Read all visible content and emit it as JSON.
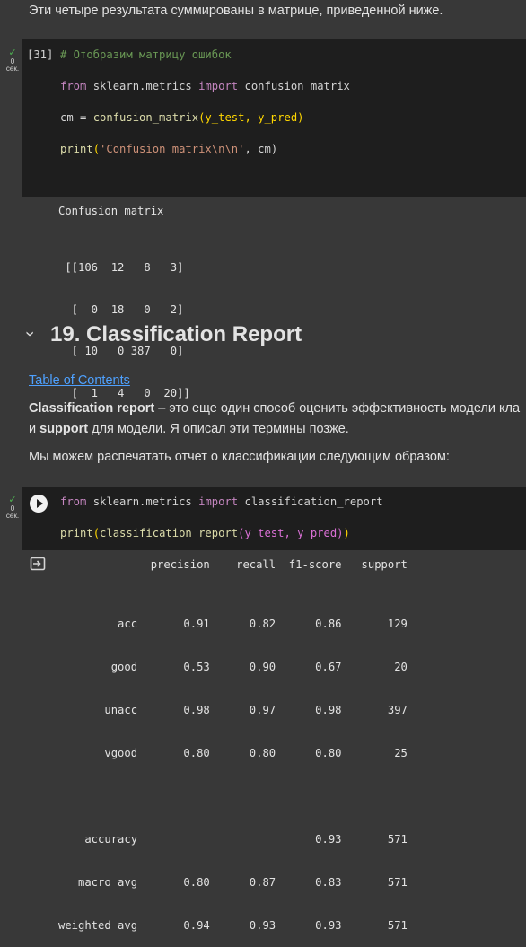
{
  "intro_text": "Эти четыре результата суммированы в матрице, приведенной ниже.",
  "cell1": {
    "status_label": "0 сек.",
    "exec_count": "[31]",
    "comment": "# Отобразим матрицу ошибок",
    "line_from": "from",
    "line_module": " sklearn.metrics ",
    "line_import": "import",
    "line_name": " confusion_matrix",
    "line2_a": "cm = ",
    "line2_fn": "confusion_matrix",
    "line2_args": "(y_test, y_pred)",
    "line3_fn": "print",
    "line3_str": "'Confusion matrix\\n\\n'",
    "line3_rest": ", cm)"
  },
  "cell1_output": {
    "title": "Confusion matrix",
    "matrix_lines": [
      " [[106  12   8   3]",
      "  [  0  18   0   2]",
      "  [ 10   0 387   0]",
      "  [  1   4   0  20]]"
    ]
  },
  "section": {
    "chevron": "›",
    "title": "19. Classification Report"
  },
  "toc_link": "Table of Contents",
  "paragraph1": {
    "bold1": "Classification report",
    "text1": " – это еще один способ оценить эффективность модели кла",
    "text2": "и ",
    "bold2": "support",
    "text3": " для модели. Я описал эти термины позже."
  },
  "paragraph2": "Мы можем распечатать отчет о классификации следующим образом:",
  "cell2": {
    "status_label": "0 сек.",
    "line1_from": "from",
    "line1_module": " sklearn.metrics ",
    "line1_import": "import",
    "line1_name": " classification_report",
    "line2_fn": "print",
    "line2_inner_fn": "classification_report",
    "line2_args": "(y_test, y_pred)"
  },
  "report": {
    "header": "              precision    recall  f1-score   support",
    "rows": [
      "         acc       0.91      0.82      0.86       129",
      "        good       0.53      0.90      0.67        20",
      "       unacc       0.98      0.97      0.98       397",
      "       vgood       0.80      0.80      0.80        25",
      "",
      "    accuracy                           0.93       571",
      "   macro avg       0.80      0.87      0.83       571",
      "weighted avg       0.94      0.93      0.93       571"
    ]
  }
}
